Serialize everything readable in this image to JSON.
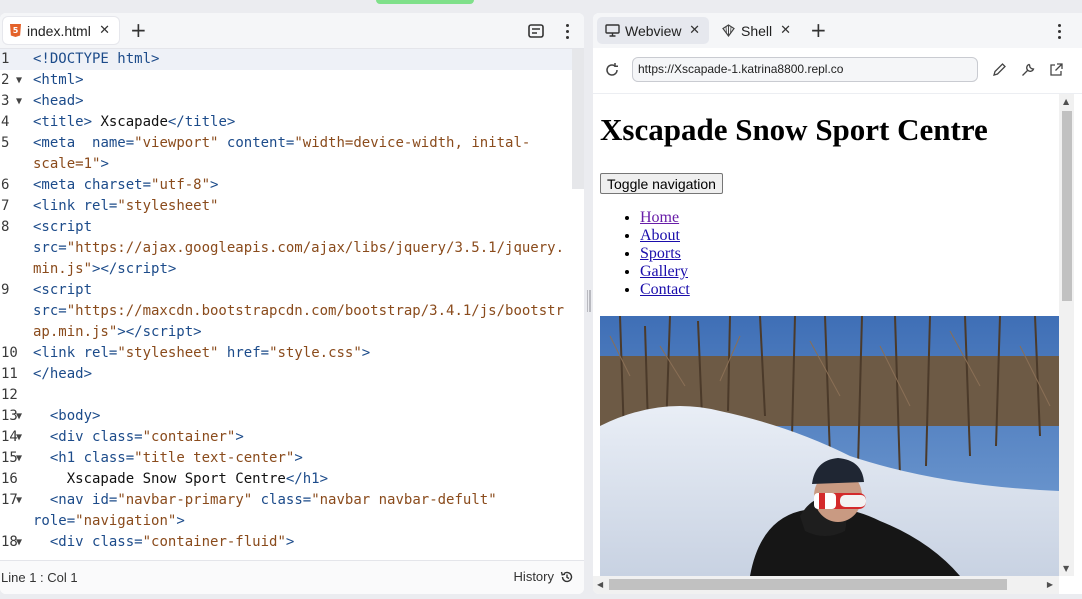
{
  "editor": {
    "tab_label": "index.html",
    "tab_icon": "html5-icon",
    "lines": [
      {
        "n": "1",
        "fold": "",
        "html": "<span class=\"c-tag\">&lt;!DOCTYPE html&gt;</span>"
      },
      {
        "n": "2",
        "fold": "▼",
        "html": "<span class=\"c-tag\">&lt;html&gt;</span>"
      },
      {
        "n": "3",
        "fold": "▼",
        "html": "<span class=\"c-tag\">&lt;head&gt;</span>"
      },
      {
        "n": "4",
        "fold": "",
        "html": "<span class=\"c-tag\">&lt;title&gt;</span><span class=\"c-txt\"> Xscapade</span><span class=\"c-tag\">&lt;/title&gt;</span>"
      },
      {
        "n": "5",
        "fold": "",
        "html": "<span class=\"c-tag\">&lt;meta</span>  <span class=\"c-attr\">name=</span><span class=\"c-str\">\"viewport\"</span> <span class=\"c-attr\">content=</span><span class=\"c-str\">\"width=device-width, inital-</span>"
      },
      {
        "n": "",
        "fold": "",
        "html": "<span class=\"c-str\">scale=1\"</span><span class=\"c-tag\">&gt;</span>"
      },
      {
        "n": "6",
        "fold": "",
        "html": "<span class=\"c-tag\">&lt;meta</span> <span class=\"c-attr\">charset=</span><span class=\"c-str\">\"utf-8\"</span><span class=\"c-tag\">&gt;</span>"
      },
      {
        "n": "7",
        "fold": "",
        "html": "<span class=\"c-tag\">&lt;link</span> <span class=\"c-attr\">rel=</span><span class=\"c-str\">\"stylesheet\"</span>"
      },
      {
        "n": "8",
        "fold": "",
        "html": "<span class=\"c-tag\">&lt;script</span>"
      },
      {
        "n": "",
        "fold": "",
        "html": "<span class=\"c-attr\">src=</span><span class=\"c-str\">\"https://ajax.googleapis.com/ajax/libs/jquery/3.5.1/jquery.</span>"
      },
      {
        "n": "",
        "fold": "",
        "html": "<span class=\"c-str\">min.js\"</span><span class=\"c-tag\">&gt;&lt;/script&gt;</span>"
      },
      {
        "n": "9",
        "fold": "",
        "html": "<span class=\"c-tag\">&lt;script</span>"
      },
      {
        "n": "",
        "fold": "",
        "html": "<span class=\"c-attr\">src=</span><span class=\"c-str\">\"https://maxcdn.bootstrapcdn.com/bootstrap/3.4.1/js/bootstr</span>"
      },
      {
        "n": "",
        "fold": "",
        "html": "<span class=\"c-str\">ap.min.js\"</span><span class=\"c-tag\">&gt;&lt;/script&gt;</span>"
      },
      {
        "n": "10",
        "fold": "",
        "html": "<span class=\"c-tag\">&lt;link</span> <span class=\"c-attr\">rel=</span><span class=\"c-str\">\"stylesheet\"</span> <span class=\"c-attr\">href=</span><span class=\"c-str\">\"style.css\"</span><span class=\"c-tag\">&gt;</span>"
      },
      {
        "n": "11",
        "fold": "",
        "html": "<span class=\"c-tag\">&lt;/head&gt;</span>"
      },
      {
        "n": "12",
        "fold": "",
        "html": ""
      },
      {
        "n": "13",
        "fold": "▼",
        "html": "  <span class=\"c-tag\">&lt;body&gt;</span>"
      },
      {
        "n": "14",
        "fold": "▼",
        "html": "  <span class=\"c-tag\">&lt;div</span> <span class=\"c-attr\">class=</span><span class=\"c-str\">\"container\"</span><span class=\"c-tag\">&gt;</span>"
      },
      {
        "n": "15",
        "fold": "▼",
        "html": "  <span class=\"c-tag\">&lt;h1</span> <span class=\"c-attr\">class=</span><span class=\"c-str\">\"title text-center\"</span><span class=\"c-tag\">&gt;</span>"
      },
      {
        "n": "16",
        "fold": "",
        "html": "    <span class=\"c-txt\">Xscapade Snow Sport Centre</span><span class=\"c-tag\">&lt;/h1&gt;</span>"
      },
      {
        "n": "17",
        "fold": "▼",
        "html": "  <span class=\"c-tag\">&lt;nav</span> <span class=\"c-attr\">id=</span><span class=\"c-str\">\"navbar-primary\"</span> <span class=\"c-attr\">class=</span><span class=\"c-str\">\"navbar navbar-defult\"</span>"
      },
      {
        "n": "",
        "fold": "",
        "html": "<span class=\"c-attr\">role=</span><span class=\"c-str\">\"navigation\"</span><span class=\"c-tag\">&gt;</span>"
      },
      {
        "n": "18",
        "fold": "▼",
        "html": "  <span class=\"c-tag\">&lt;div</span> <span class=\"c-attr\">class=</span><span class=\"c-str\">\"container-fluid\"</span><span class=\"c-tag\">&gt;</span>"
      }
    ],
    "status": {
      "cursor": "Line 1 : Col 1",
      "history": "History"
    }
  },
  "webview": {
    "tabs": [
      {
        "label": "Webview",
        "icon": "monitor-icon",
        "active": true
      },
      {
        "label": "Shell",
        "icon": "shell-icon",
        "active": false
      }
    ],
    "url": "https://Xscapade-1.katrina8800.repl.co",
    "page": {
      "heading": "Xscapade Snow Sport Centre",
      "toggle_button": "Toggle navigation",
      "nav": [
        "Home",
        "About",
        "Sports",
        "Gallery",
        "Contact"
      ],
      "photo": "snowboarder-photo"
    }
  },
  "colors": {
    "accent_indicator": "#7fe08a",
    "code_tag": "#1c4b8a",
    "code_string": "#8a4b1c",
    "link": "#1a0dab",
    "link_visited": "#681da8"
  }
}
